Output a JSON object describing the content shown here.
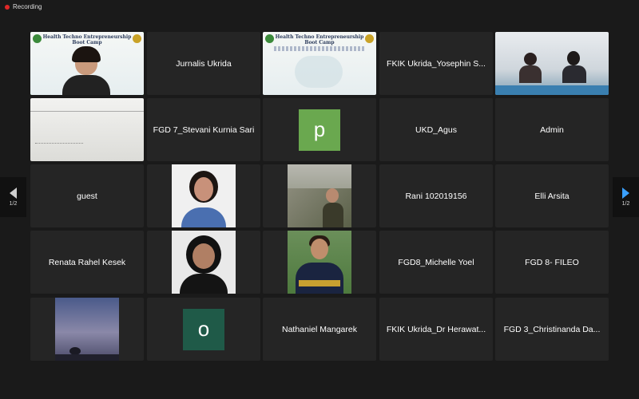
{
  "status": {
    "recording_label": "Recording",
    "recording_color": "#e02828"
  },
  "pagination": {
    "left_label": "1/2",
    "right_label": "1/2"
  },
  "banner": {
    "title_line1": "Health Techno Entrepreneurship",
    "title_line2": "Boot Camp"
  },
  "participants": [
    {
      "name": "Jurnalis Ukrida"
    },
    {
      "name": "FKIK Ukrida_Yosephin S..."
    },
    {
      "name": "FGD 7_Stevani Kurnia Sari"
    },
    {
      "initial": "p",
      "color": "#6aa84f"
    },
    {
      "name": "UKD_Agus"
    },
    {
      "name": "Admin"
    },
    {
      "name": "guest"
    },
    {
      "name": "Rani 102019156"
    },
    {
      "name": "Elli Arsita"
    },
    {
      "name": "Renata Rahel Kesek"
    },
    {
      "name": "FGD8_Michelle Yoel"
    },
    {
      "name": "FGD 8- FILEO"
    },
    {
      "initial": "o",
      "color": "#1f5a48"
    },
    {
      "name": "Nathaniel Mangarek"
    },
    {
      "name": "FKIK Ukrida_Dr Herawat..."
    },
    {
      "name": "FGD 3_Christinanda Da..."
    }
  ]
}
